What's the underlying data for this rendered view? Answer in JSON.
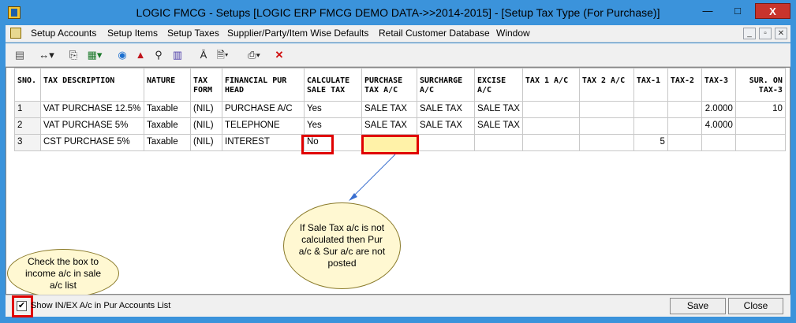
{
  "titlebar": {
    "title": "LOGIC FMCG - Setups  [LOGIC ERP FMCG DEMO DATA->>2014-2015] - [Setup Tax Type (For Purchase)]",
    "min": "—",
    "max": "□",
    "close": "X"
  },
  "menu": {
    "items": [
      "Setup Accounts",
      "Setup Items",
      "Setup Taxes",
      "Supplier/Party/Item Wise Defaults",
      "Retail Customer Database",
      "Window"
    ],
    "mdi_min": "_",
    "mdi_restore": "▫",
    "mdi_close": "✕"
  },
  "table": {
    "headers": [
      "SNO.",
      "TAX DESCRIPTION",
      "NATURE",
      "TAX FORM",
      "FINANCIAL PUR HEAD",
      "CALCULATE SALE TAX",
      "PURCHASE TAX A/C",
      "SURCHARGE A/C",
      "EXCISE A/C",
      "TAX 1 A/C",
      "TAX 2 A/C",
      "TAX-1",
      "TAX-2",
      "TAX-3",
      "SUR. ON TAX-3"
    ],
    "rows": [
      [
        "1",
        "VAT PURCHASE 12.5%",
        "Taxable",
        "(NIL)",
        "PURCHASE A/C",
        "Yes",
        "SALE TAX",
        "SALE TAX",
        "SALE TAX",
        "",
        "",
        "",
        "",
        "2.0000",
        "10"
      ],
      [
        "2",
        "VAT PURCHASE 5%",
        "Taxable",
        "(NIL)",
        "TELEPHONE",
        "Yes",
        "SALE TAX",
        "SALE TAX",
        "SALE TAX",
        "",
        "",
        "",
        "",
        "4.0000",
        ""
      ],
      [
        "3",
        "CST PURCHASE 5%",
        "Taxable",
        "(NIL)",
        "INTEREST",
        "No",
        "",
        "",
        "",
        "",
        "",
        "5",
        "",
        "",
        ""
      ]
    ]
  },
  "callouts": {
    "center": "If Sale Tax a/c is not calculated then Pur a/c & Sur a/c are not posted",
    "left": "Check the box to income a/c in sale a/c list"
  },
  "footer": {
    "checkbox_checked": "✔",
    "checkbox_label": "Show IN/EX A/c in Pur Accounts List",
    "save_label": "Save",
    "close_label": "Close"
  },
  "colors": {
    "title_bg": "#3b93db",
    "highlight_red": "#e00000",
    "highlight_yellow": "#fff2a8"
  }
}
